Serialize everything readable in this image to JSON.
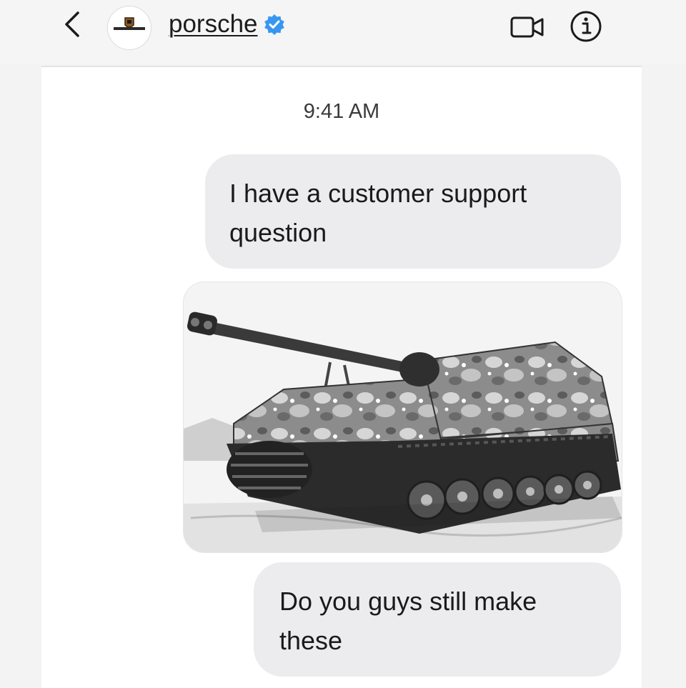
{
  "header": {
    "username": "porsche",
    "verified": true,
    "icons": {
      "back": "chevron-left-icon",
      "avatar": "porsche-crest-logo",
      "verified": "verified-badge-icon",
      "video": "video-camera-icon",
      "info": "info-icon"
    }
  },
  "chat": {
    "timestamp": "9:41 AM",
    "messages": [
      {
        "type": "text",
        "text": "I have a customer support question"
      },
      {
        "type": "image",
        "description_icon": "tank-photo"
      },
      {
        "type": "text",
        "text": "Do you guys still make these"
      }
    ]
  },
  "colors": {
    "verified_blue": "#3797f0",
    "bubble_bg": "#ececee",
    "text": "#1a1a1a"
  }
}
